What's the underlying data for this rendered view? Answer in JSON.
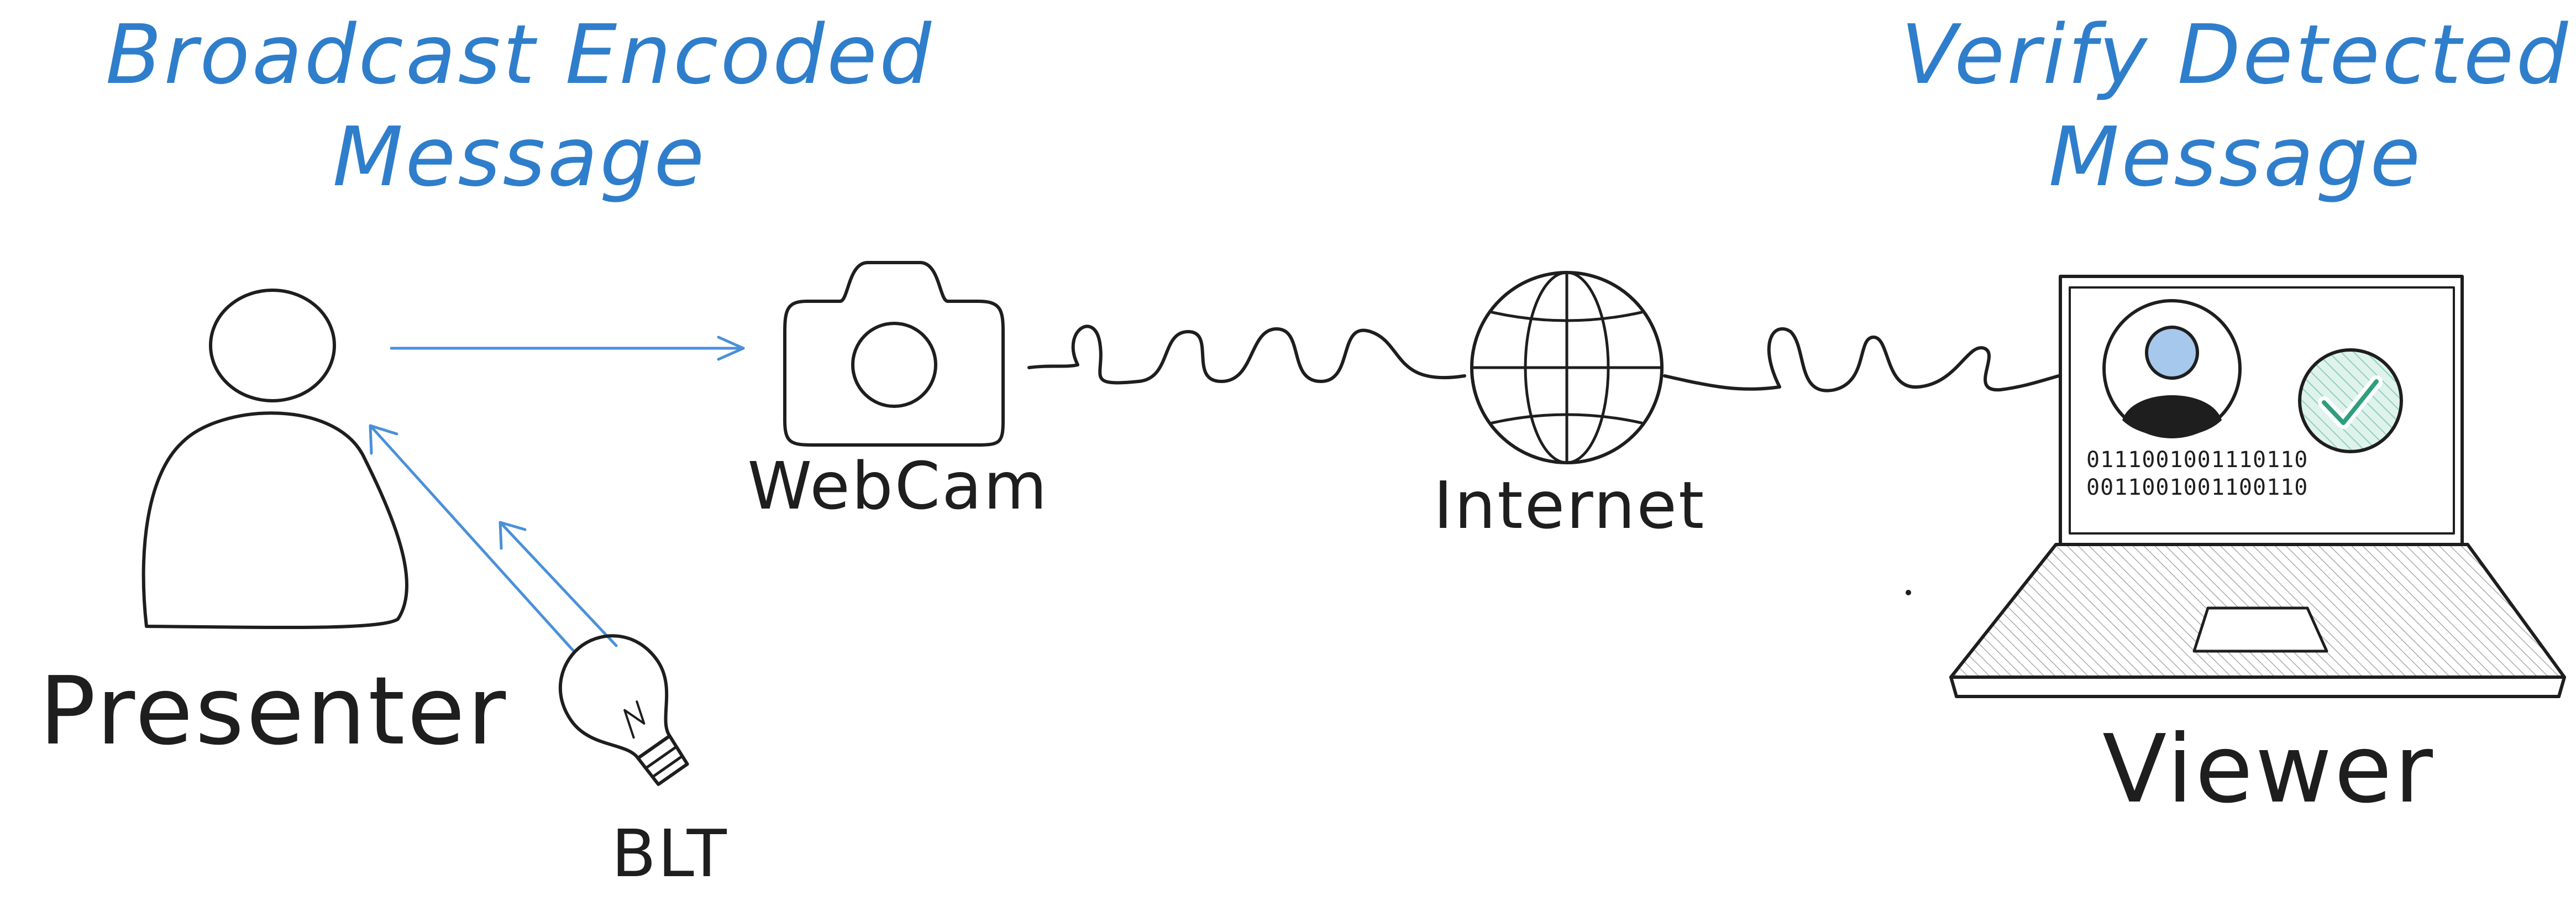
{
  "headings": {
    "left_line1": "Broadcast Encoded",
    "left_line2": "Message",
    "right_line1": "Verify Detected",
    "right_line2": "Message"
  },
  "labels": {
    "presenter": "Presenter",
    "blt": "BLT",
    "webcam": "WebCam",
    "internet": "Internet",
    "viewer": "Viewer"
  },
  "screen": {
    "binary_line1": "0111001001110110",
    "binary_line2": "0011001001100110"
  },
  "icons": {
    "presenter": "person-icon",
    "bulb": "lightbulb-icon",
    "camera": "camera-icon",
    "globe": "globe-icon",
    "laptop": "laptop-icon",
    "avatar": "user-avatar-icon",
    "check": "checkmark-badge-icon"
  },
  "colors": {
    "heading_blue": "#2f7ecb",
    "ink": "#1e1e1e",
    "arrow_blue": "#4a90d9",
    "avatar_blue": "#a5c8ec",
    "check_green": "#2f9e7d",
    "check_fill": "#d5efe6"
  }
}
